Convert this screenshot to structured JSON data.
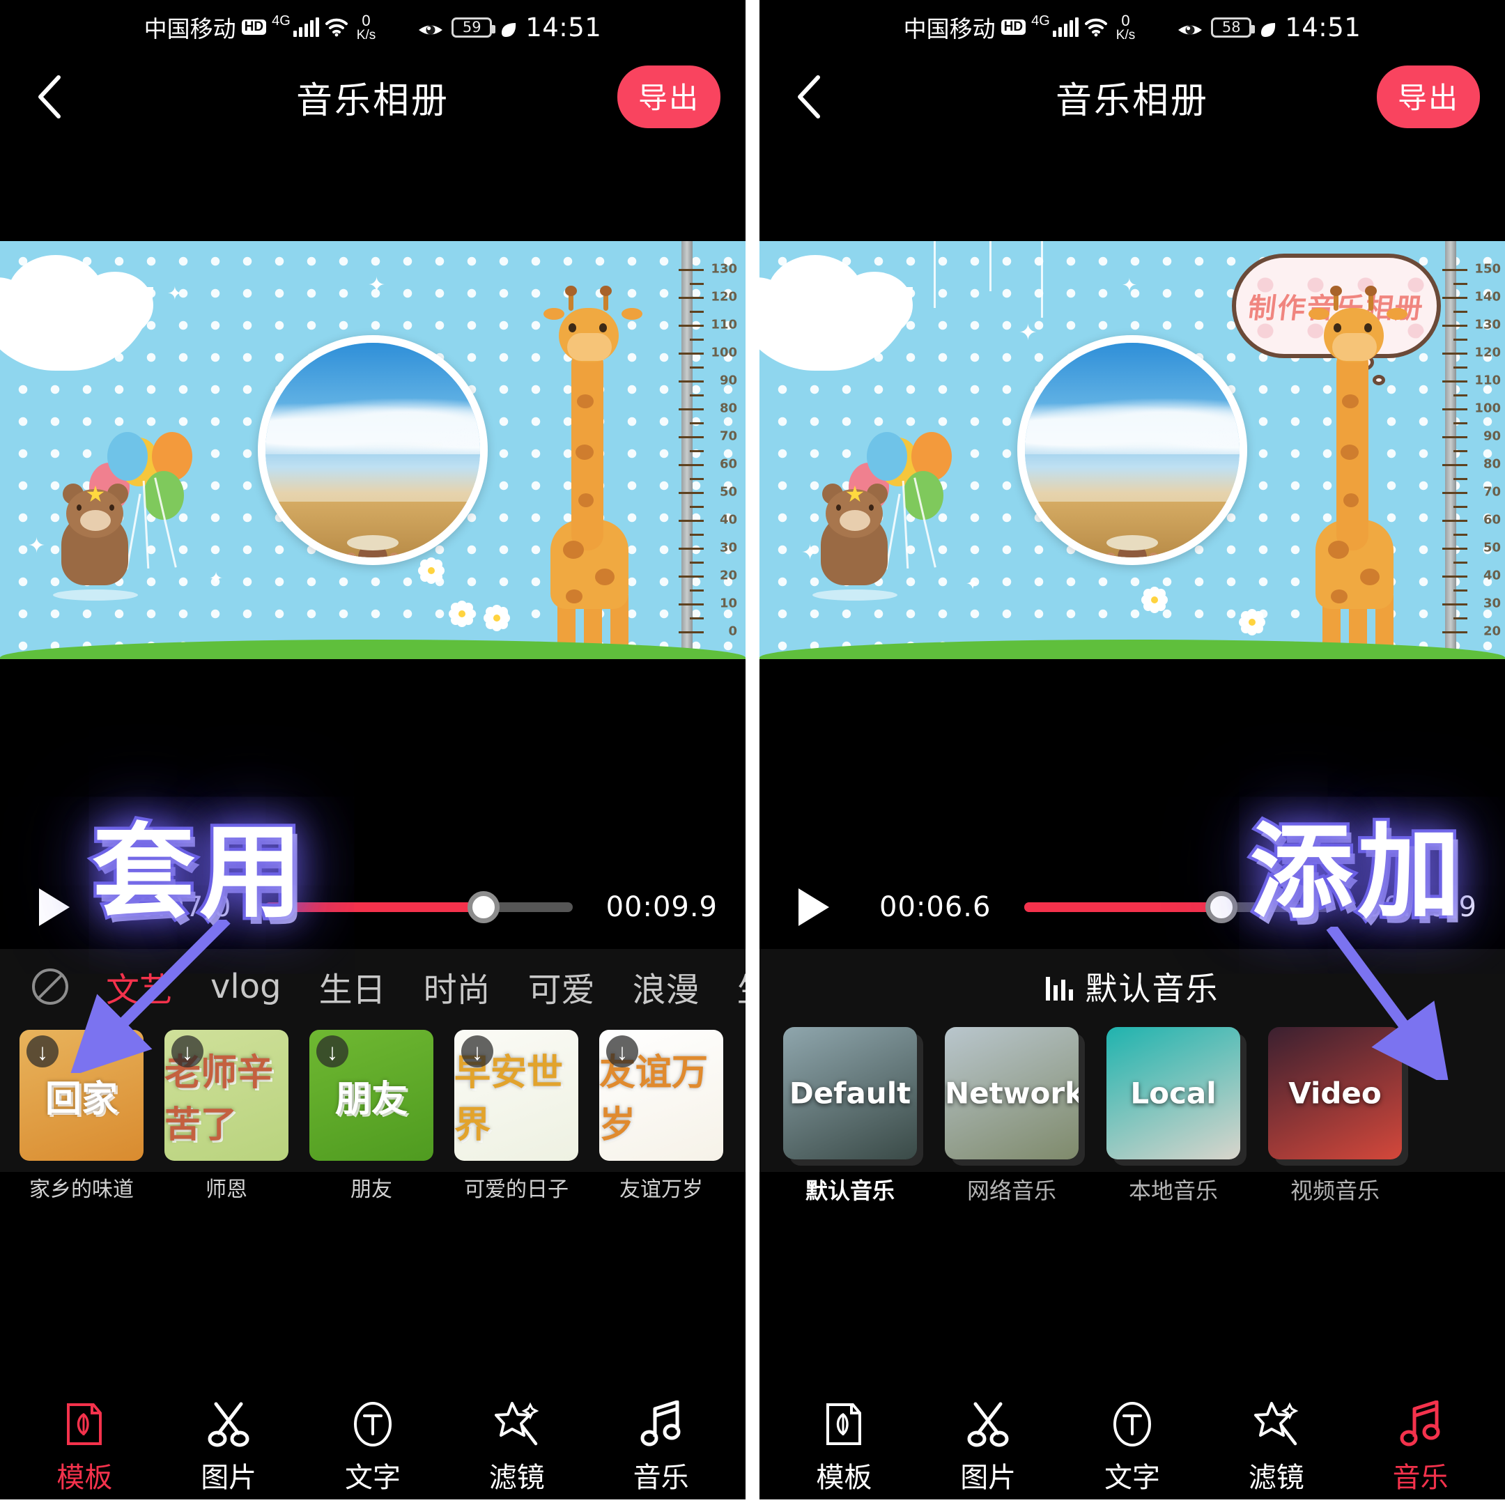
{
  "app": {
    "title": "音乐相册",
    "export_label": "导出",
    "back_icon": "chevron-left-icon",
    "accent_color": "#f4324c",
    "export_color": "#f9445f"
  },
  "annotations": {
    "left": "套用",
    "right": "添加",
    "glow_color": "#7b73f0"
  },
  "panels": [
    {
      "id": "left",
      "statusbar": {
        "carrier": "中国移动",
        "hd_badge": "HD",
        "network": "4G",
        "speed_value": "0",
        "speed_unit": "K/s",
        "eye_icon": "eye-comfort-icon",
        "battery": "59",
        "battery_saver_icon": "leaf-icon",
        "time": "14:51"
      },
      "player": {
        "current": "00:07.0",
        "total": "00:09.9",
        "progress_percent": 71,
        "play_icon": "play-icon"
      },
      "preview": {
        "has_bubble": false,
        "bubble_text": ""
      },
      "tabs": [
        {
          "label": "禁用",
          "icon": "ban-icon",
          "active": false,
          "is_icon": true
        },
        {
          "label": "文艺",
          "active": true,
          "is_icon": false
        },
        {
          "label": "vlog",
          "active": false,
          "is_icon": false
        },
        {
          "label": "生日",
          "active": false,
          "is_icon": false
        },
        {
          "label": "时尚",
          "active": false,
          "is_icon": false
        },
        {
          "label": "可爱",
          "active": false,
          "is_icon": false
        },
        {
          "label": "浪漫",
          "active": false,
          "is_icon": false
        },
        {
          "label": "生活",
          "active": false,
          "is_icon": false
        }
      ],
      "templates": [
        {
          "caption": "家乡的味道",
          "art_text": "回家",
          "c1": "#e8b35c",
          "c2": "#d98b2f",
          "txt": "#ffffff"
        },
        {
          "caption": "师恩",
          "art_text": "老师辛苦了",
          "c1": "#cfe09a",
          "c2": "#b9d37e",
          "txt": "#c4603f"
        },
        {
          "caption": "朋友",
          "art_text": "朋友",
          "c1": "#6fb832",
          "c2": "#4f9b20",
          "txt": "#ffffff"
        },
        {
          "caption": "可爱的日子",
          "art_text": "早安世界",
          "c1": "#fbfbf6",
          "c2": "#eef1e2",
          "txt": "#e2a32c"
        },
        {
          "caption": "友谊万岁",
          "art_text": "友谊万岁",
          "c1": "#ffffff",
          "c2": "#f6f2e8",
          "txt": "#e08a2e"
        }
      ],
      "nav": [
        {
          "label": "模板",
          "icon": "template-icon",
          "active": true
        },
        {
          "label": "图片",
          "icon": "scissors-icon",
          "active": false
        },
        {
          "label": "文字",
          "icon": "text-t-icon",
          "active": false
        },
        {
          "label": "滤镜",
          "icon": "magic-wand-icon",
          "active": false
        },
        {
          "label": "音乐",
          "icon": "music-note-icon",
          "active": false
        }
      ]
    },
    {
      "id": "right",
      "statusbar": {
        "carrier": "中国移动",
        "hd_badge": "HD",
        "network": "4G",
        "speed_value": "0",
        "speed_unit": "K/s",
        "eye_icon": "eye-comfort-icon",
        "battery": "58",
        "battery_saver_icon": "leaf-icon",
        "time": "14:51"
      },
      "player": {
        "current": "00:06.6",
        "total": "00:09.9",
        "progress_percent": 64,
        "play_icon": "play-icon"
      },
      "preview": {
        "has_bubble": true,
        "bubble_text": "制作音乐相册"
      },
      "music_header": {
        "label": "默认音乐",
        "icon": "equalizer-icon"
      },
      "music_sources": [
        {
          "art_text": "Default",
          "caption": "默认音乐",
          "selected": true,
          "c1": "#8fa6ad",
          "c2": "#3a4a47"
        },
        {
          "art_text": "Network",
          "caption": "网络音乐",
          "selected": false,
          "c1": "#b9c6cd",
          "c2": "#7f8a6b"
        },
        {
          "art_text": "Local",
          "caption": "本地音乐",
          "selected": false,
          "c1": "#1fb3ae",
          "c2": "#d9d5cc"
        },
        {
          "art_text": "Video",
          "caption": "视频音乐",
          "selected": false,
          "c1": "#3a2030",
          "c2": "#d4483b"
        }
      ],
      "nav": [
        {
          "label": "模板",
          "icon": "template-icon",
          "active": false
        },
        {
          "label": "图片",
          "icon": "scissors-icon",
          "active": false
        },
        {
          "label": "文字",
          "icon": "text-t-icon",
          "active": false
        },
        {
          "label": "滤镜",
          "icon": "magic-wand-icon",
          "active": false
        },
        {
          "label": "音乐",
          "icon": "music-note-icon",
          "active": true
        }
      ]
    }
  ],
  "preview_scene": {
    "ruler_ticks": [
      "130",
      "120",
      "110",
      "100",
      "90",
      "80",
      "70",
      "60",
      "50",
      "40",
      "30",
      "20",
      "10",
      "0"
    ],
    "ruler_ticks_right": [
      "150",
      "140",
      "130",
      "120",
      "110",
      "100",
      "90",
      "80",
      "70",
      "60",
      "50",
      "40",
      "30",
      "20"
    ]
  }
}
